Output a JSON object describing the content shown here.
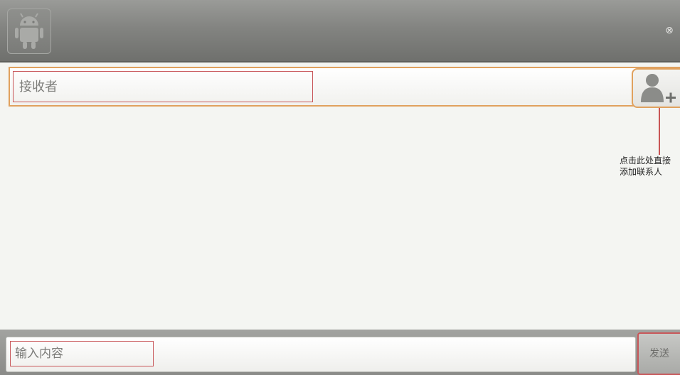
{
  "header": {
    "app_icon": "android-robot-icon",
    "close_icon": "close-circle-icon",
    "close_glyph": "⊗"
  },
  "recipient": {
    "placeholder": "接收者",
    "add_contact_icon": "add-contact-icon"
  },
  "annotation": {
    "text": "点击此处直接\n添加联系人"
  },
  "compose": {
    "placeholder": "输入内容",
    "send_label": "发送"
  },
  "colors": {
    "highlight_orange": "#e0a15e",
    "annotation_red": "#c8575a",
    "toolbar_gray": "#838481"
  }
}
